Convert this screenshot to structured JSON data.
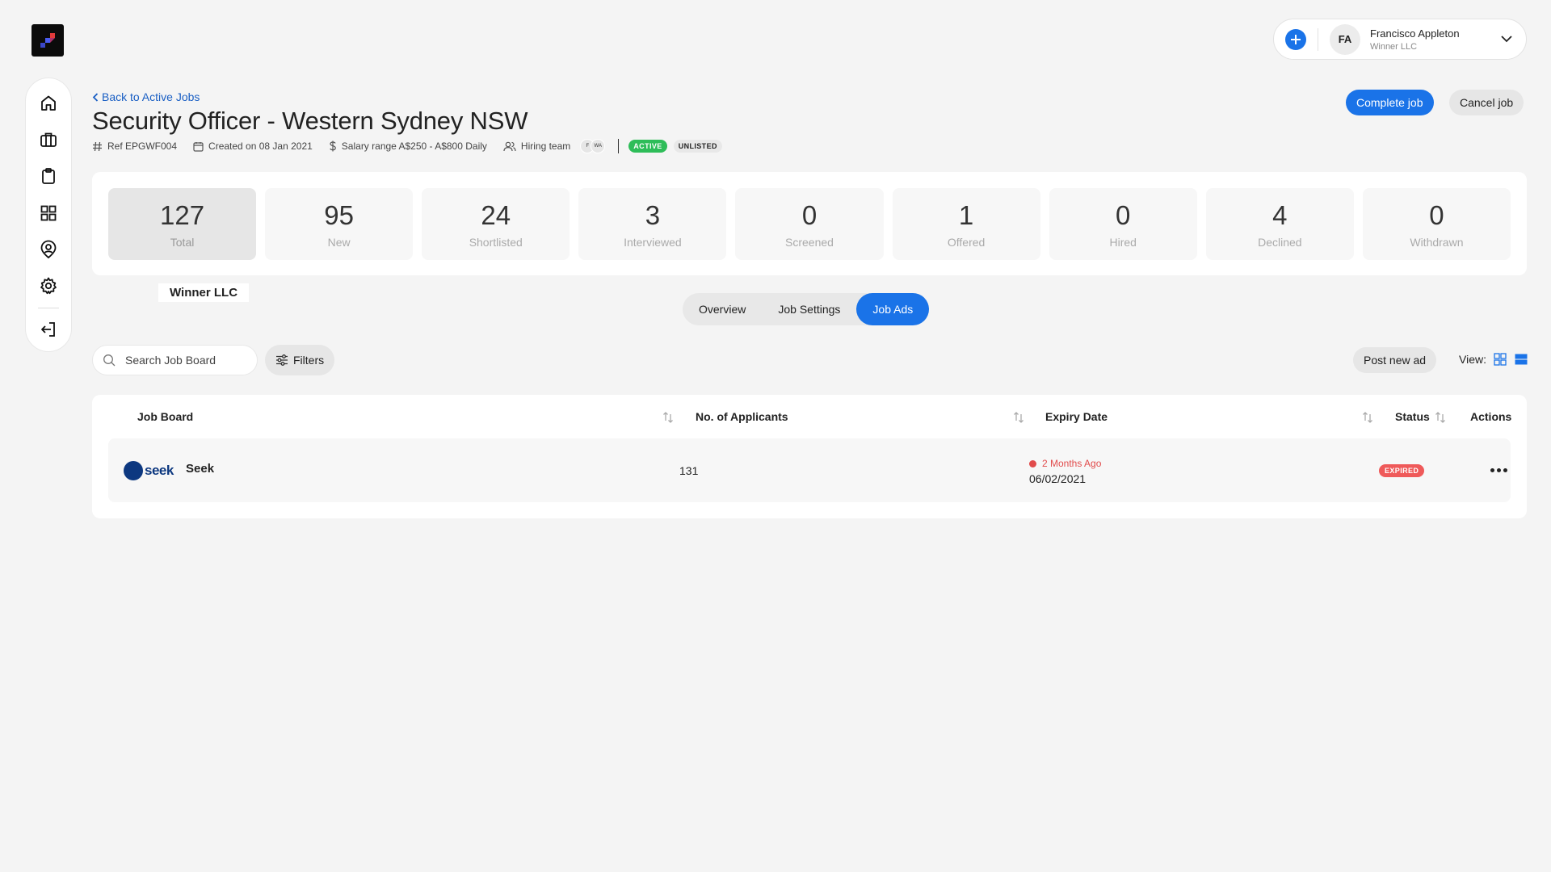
{
  "header": {
    "back_link": "Back to Active Jobs",
    "title": "Security Officer - Western Sydney NSW",
    "ref": "Ref EPGWF004",
    "created": "Created on 08 Jan 2021",
    "salary": "Salary range A$250 - A$800 Daily",
    "hiring_team_label": "Hiring team",
    "hiring_team": [
      "F",
      "WA"
    ],
    "status_active": "ACTIVE",
    "status_unlisted": "UNLISTED",
    "complete_job": "Complete job",
    "cancel_job": "Cancel job"
  },
  "user": {
    "initials": "FA",
    "name": "Francisco Appleton",
    "company": "Winner LLC"
  },
  "stats": [
    {
      "value": "127",
      "label": "Total",
      "selected": true
    },
    {
      "value": "95",
      "label": "New"
    },
    {
      "value": "24",
      "label": "Shortlisted"
    },
    {
      "value": "3",
      "label": "Interviewed"
    },
    {
      "value": "0",
      "label": "Screened"
    },
    {
      "value": "1",
      "label": "Offered"
    },
    {
      "value": "0",
      "label": "Hired"
    },
    {
      "value": "4",
      "label": "Declined"
    },
    {
      "value": "0",
      "label": "Withdrawn"
    }
  ],
  "company_tag": "Winner LLC",
  "tabs": [
    {
      "label": "Overview"
    },
    {
      "label": "Job Settings"
    },
    {
      "label": "Job Ads",
      "active": true
    }
  ],
  "toolbar": {
    "search_placeholder": "Search Job Board",
    "filters": "Filters",
    "post_new_ad": "Post new ad",
    "view_label": "View:"
  },
  "table": {
    "columns": [
      "Job Board",
      "No. of Applicants",
      "Expiry Date",
      "Status",
      "Actions"
    ],
    "rows": [
      {
        "logo_text": "seek",
        "job_board": "Seek",
        "applicants": "131",
        "expiry_relative": "2 Months Ago",
        "expiry_date": "06/02/2021",
        "status": "EXPIRED"
      }
    ]
  },
  "sidebar": {
    "icons": [
      "home-icon",
      "briefcase-icon",
      "clipboard-icon",
      "grid-icon",
      "user-pin-icon",
      "gear-icon",
      "logout-icon"
    ]
  },
  "colors": {
    "accent": "#1a73e8",
    "active_badge": "#2ebd59",
    "expired": "#ef5a5a"
  }
}
